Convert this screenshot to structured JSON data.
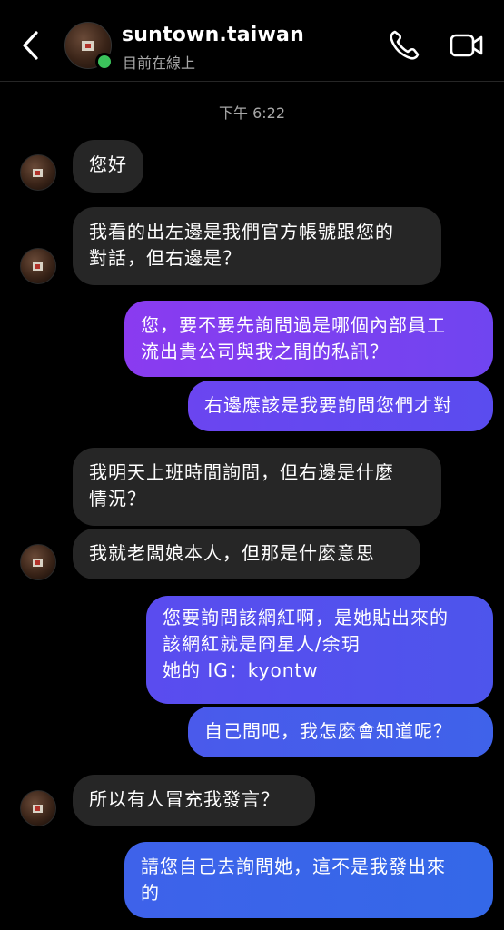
{
  "header": {
    "username": "suntown.taiwan",
    "status": "目前在線上",
    "icons": [
      "back-chevron-icon",
      "phone-icon",
      "video-camera-icon"
    ],
    "online_color": "#3bc25b"
  },
  "conversation": {
    "timestamp": "下午 6:22",
    "messages": [
      {
        "from": "them",
        "text": "您好"
      },
      {
        "from": "them",
        "text": "我看的出左邊是我們官方帳號跟您的\n對話，但右邊是？"
      },
      {
        "from": "me",
        "text": "您，要不要先詢問過是哪個內部員工\n流出貴公司與我之間的私訊？"
      },
      {
        "from": "me",
        "text": "右邊應該是我要詢問您們才對"
      },
      {
        "from": "them",
        "text": "我明天上班時間詢問，但右邊是什麼\n情況？"
      },
      {
        "from": "them",
        "text": "我就老闆娘本人，但那是什麼意思"
      },
      {
        "from": "me",
        "text": "您要詢問該網紅啊，是她貼出來的\n該網紅就是冏星人/余玥\n她的 IG：kyontw"
      },
      {
        "from": "me",
        "text": "自己問吧，我怎麼會知道呢？"
      },
      {
        "from": "them",
        "text": "所以有人冒充我發言？"
      },
      {
        "from": "me",
        "text": "請您自己去詢問她，這不是我發出來\n的"
      }
    ]
  },
  "colors": {
    "background": "#000000",
    "incoming_bubble": "#262626",
    "outgoing_purple": "#7a3ff0",
    "outgoing_blue": "#3d5fea",
    "secondary_text": "#a8a8a8"
  }
}
